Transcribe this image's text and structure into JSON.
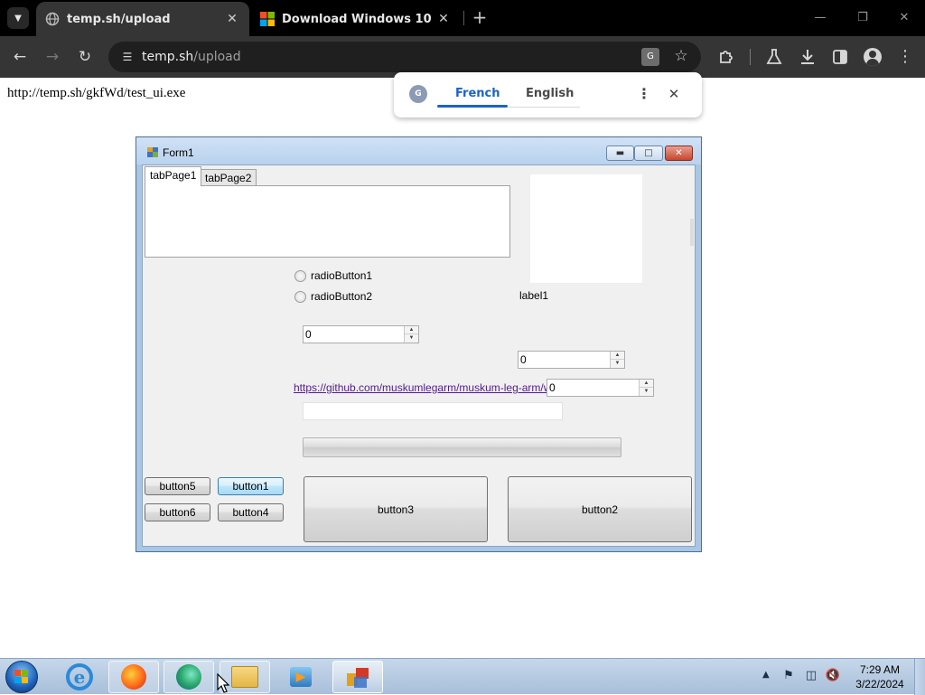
{
  "browser": {
    "tabs": [
      {
        "title": "temp.sh/upload",
        "active": true
      },
      {
        "title": "Download Windows 10",
        "active": false
      }
    ],
    "address": {
      "host": "temp.sh",
      "path": "/upload"
    },
    "icons": {
      "tab_search": "chevron-down-icon",
      "back": "arrow-left-icon",
      "forward": "arrow-right-icon",
      "reload": "reload-icon",
      "site_info": "tune-icon",
      "translate": "translate-icon",
      "bookmark": "star-icon",
      "extensions": "puzzle-icon",
      "labs": "flask-icon",
      "downloads": "download-icon",
      "side_panel": "side-panel-icon",
      "profile": "profile-icon",
      "menu": "kebab-menu-icon"
    }
  },
  "page": {
    "text": "http://temp.sh/gkfWd/test_ui.exe"
  },
  "translate_popup": {
    "source_lang": "French",
    "target_lang": "English",
    "accent_color": "#1a63c9"
  },
  "form1": {
    "title": "Form1",
    "tabs": [
      "tabPage1",
      "tabPage2"
    ],
    "radio1": "radioButton1",
    "radio2": "radioButton2",
    "label1": "label1",
    "updown1_value": "0",
    "updown2_value": "0",
    "updown3_value": "0",
    "link": "https://github.com/muskumlegarm/muskum-leg-arm/wiki",
    "textbox_value": "",
    "progress": 0,
    "buttons": {
      "button1": "button1",
      "button2": "button2",
      "button3": "button3",
      "button4": "button4",
      "button5": "button5",
      "button6": "button6"
    }
  },
  "taskbar": {
    "apps": [
      "internet-explorer-icon",
      "firefox-icon",
      "edge-icon",
      "file-explorer-icon",
      "media-player-icon",
      "form-app-icon"
    ],
    "clock_time": "7:29 AM",
    "clock_date": "3/22/2024"
  }
}
